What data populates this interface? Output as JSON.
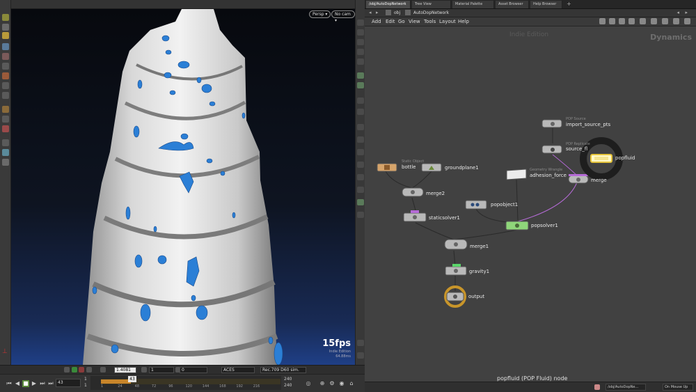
{
  "viewport": {
    "view_dropdown": "Persp ▾",
    "camera_dropdown": "No cam ▾",
    "fps": "15fps",
    "indie_label": "Indie Edition",
    "stat_label": "64.88ms"
  },
  "playbar": {
    "zoom_value": "1.4081",
    "step_value": "1",
    "offset_value": "0",
    "color_space": "ACES",
    "display_transform": "Rec.709 D60 sim.",
    "current_frame": "43",
    "current_frame_field": "43",
    "start_frame": "1",
    "start_frame_2": "1",
    "end_frame": "240",
    "end_frame_2": "240",
    "ticks": [
      "1",
      "24",
      "48",
      "72",
      "96",
      "120",
      "144",
      "168",
      "192",
      "216"
    ]
  },
  "network": {
    "tabs": [
      "/obj/AutoDopNetwork",
      "Tree View",
      "Material Palette",
      "Asset Browser",
      "Help Browser"
    ],
    "path_obj": "obj",
    "path_network": "AutoDopNetwork",
    "menu": [
      "Add",
      "Edit",
      "Go",
      "View",
      "Tools",
      "Layout",
      "Help"
    ],
    "watermark": "Indie Edition",
    "context_label": "Dynamics",
    "node_info": "popfluid (POP Fluid) node",
    "status_path": "/obj/AutoDopNe...",
    "status_mode": "On Mouse Up",
    "nodes": {
      "import_source_type": "POP Source",
      "import_source_name": "import_source_pts",
      "source_replicate_type": "POP Replicate",
      "source_replicate_name": "source_fl",
      "popfluid_name": "popfluid",
      "merge_top": "merge",
      "static_object_type": "Static Object",
      "bottle": "bottle",
      "groundplane": "groundplane1",
      "geometry_wrangle_type": "Geometry Wrangle",
      "adhesion_force": "adhesion_force",
      "merge2": "merge2",
      "popobject": "popobject1",
      "staticsolver": "staticsolver1",
      "popsolver": "popsolver1",
      "merge1": "merge1",
      "gravity": "gravity1",
      "output": "output"
    }
  }
}
